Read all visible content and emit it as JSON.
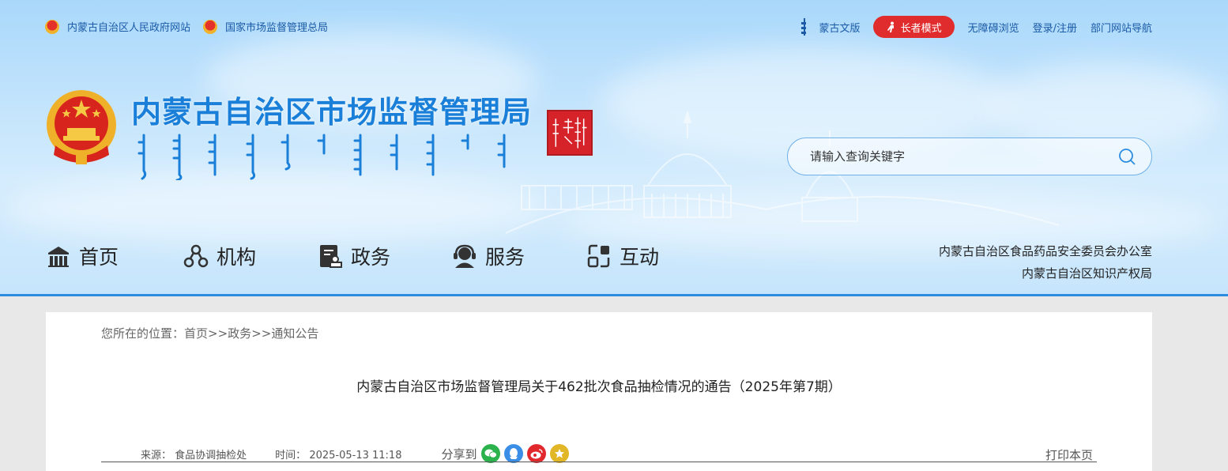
{
  "top_links": {
    "gov_site": "内蒙古自治区人民政府网站",
    "samr_site": "国家市场监督管理总局",
    "mongolian": "蒙古文版",
    "elder_mode": "长者模式",
    "accessible": "无障碍浏览",
    "login": "登录/注册",
    "dept_nav": "部门网站导航"
  },
  "site": {
    "title": "内蒙古自治区市场监督管理局"
  },
  "search": {
    "placeholder": "请输入查询关键字"
  },
  "nav": {
    "items": [
      {
        "label": "首页",
        "icon": "home-icon"
      },
      {
        "label": "机构",
        "icon": "organization-icon"
      },
      {
        "label": "政务",
        "icon": "government-affairs-icon"
      },
      {
        "label": "服务",
        "icon": "service-icon"
      },
      {
        "label": "互动",
        "icon": "interaction-icon"
      }
    ],
    "right_links": [
      "内蒙古自治区食品药品安全委员会办公室",
      "内蒙古自治区知识产权局"
    ]
  },
  "breadcrumb": {
    "prefix": "您所在的位置：",
    "home": "首页",
    "sep": ">>",
    "section": "政务",
    "page": "通知公告"
  },
  "article": {
    "title": "内蒙古自治区市场监督管理局关于462批次食品抽检情况的通告（2025年第7期）",
    "source_label": "来源：",
    "source": "食品协调抽检处",
    "time_label": "时间：",
    "time": "2025-05-13 11:18",
    "share_label": "分享到",
    "print_label": "打印本页"
  },
  "colors": {
    "accent": "#1a7fd8",
    "elder_btn": "#e02c2c",
    "wechat": "#2bb24c",
    "qq": "#3a8ee6",
    "weibo": "#e0282d",
    "favorite": "#e1b627"
  }
}
